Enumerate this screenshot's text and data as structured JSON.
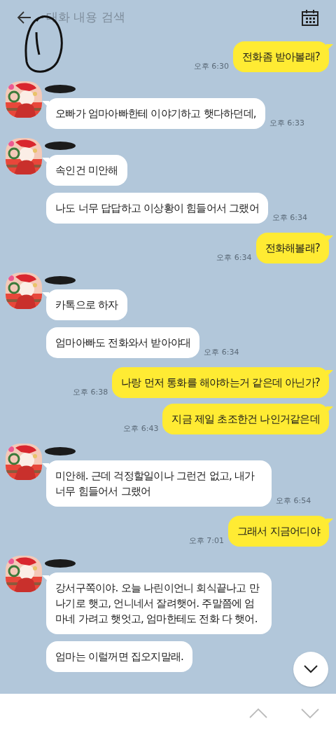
{
  "search": {
    "placeholder": "대화 내용 검색"
  },
  "messages": [
    {
      "kind": "sent",
      "text": "전화좀 받아볼래?",
      "time": "오후 6:30"
    },
    {
      "kind": "received",
      "bubbles": [
        "오빠가 엄마아빠한테 이야기하고 햇다하던데,"
      ],
      "time": "오후 6:33"
    },
    {
      "kind": "received",
      "bubbles": [
        "속인건 미안해",
        "나도 너무 답답하고 이상황이 힘들어서 그랬어"
      ],
      "time": "오후 6:34"
    },
    {
      "kind": "sent",
      "text": "전화해볼래?",
      "time": "오후 6:34"
    },
    {
      "kind": "received",
      "bubbles": [
        "카톡으로 하자",
        "엄마아빠도 전화와서 받아야대"
      ],
      "time": "오후 6:34"
    },
    {
      "kind": "sent",
      "text": "나랑 먼저 통화를 해야하는거 같은데 아닌가?",
      "time": "오후 6:38"
    },
    {
      "kind": "sent",
      "text": "지금 제일 초조한건 나인거같은데",
      "time": "오후 6:43"
    },
    {
      "kind": "received",
      "bubbles": [
        "미안해. 근데 걱정할일이나 그런건 없고, 내가 너무 힘들어서 그랬어"
      ],
      "time": "오후 6:54"
    },
    {
      "kind": "sent",
      "text": "그래서 지금어디야",
      "time": "오후 7:01"
    },
    {
      "kind": "received",
      "bubbles": [
        "강서구쪽이야. 오늘 나린이언니 회식끝나고 만나기로 햇고, 언니네서 잘려햇어. 주말쯤에 엄마네 가려고 햇엇고, 엄마한테도 전화 다 햇어.",
        "엄마는 이럴꺼면 집오지말래."
      ]
    }
  ]
}
